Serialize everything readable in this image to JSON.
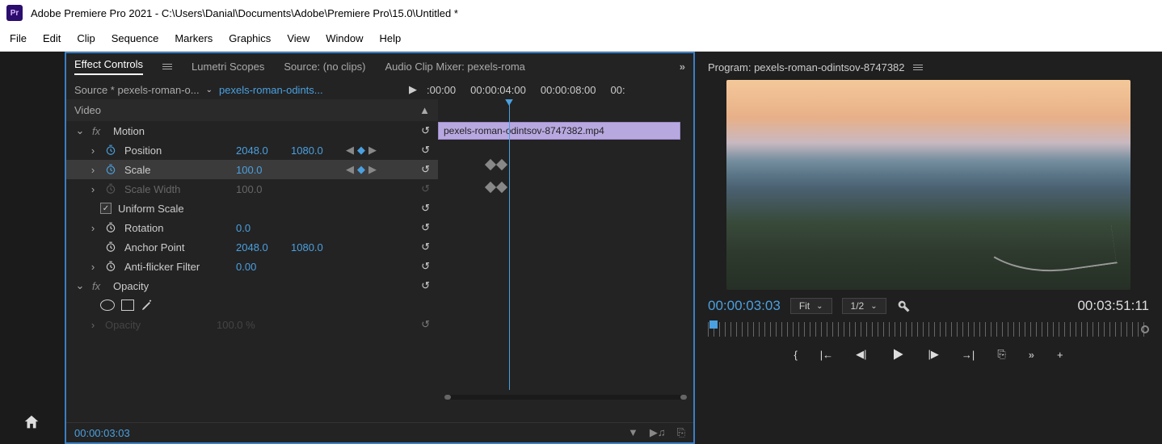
{
  "window_title": "Adobe Premiere Pro 2021 - C:\\Users\\Danial\\Documents\\Adobe\\Premiere Pro\\15.0\\Untitled *",
  "app_icon_text": "Pr",
  "menu": {
    "file": "File",
    "edit": "Edit",
    "clip": "Clip",
    "sequence": "Sequence",
    "markers": "Markers",
    "graphics": "Graphics",
    "view": "View",
    "window": "Window",
    "help": "Help"
  },
  "tabs": {
    "effect_controls": "Effect Controls",
    "lumetri": "Lumetri Scopes",
    "source": "Source: (no clips)",
    "audio_mixer": "Audio Clip Mixer: pexels-roma"
  },
  "source_line": {
    "src": "Source * pexels-roman-o...",
    "seq": "pexels-roman-odints..."
  },
  "time_ruler": {
    "t0": ":00:00",
    "t1": "00:00:04:00",
    "t2": "00:00:08:00",
    "t3": "00:"
  },
  "video_header": "Video",
  "effects": {
    "motion": {
      "label": "Motion"
    },
    "position": {
      "label": "Position",
      "x": "2048.0",
      "y": "1080.0"
    },
    "scale": {
      "label": "Scale",
      "val": "100.0"
    },
    "scale_width": {
      "label": "Scale Width",
      "val": "100.0"
    },
    "uniform_scale": {
      "label": "Uniform Scale"
    },
    "rotation": {
      "label": "Rotation",
      "val": "0.0"
    },
    "anchor": {
      "label": "Anchor Point",
      "x": "2048.0",
      "y": "1080.0"
    },
    "anti_flicker": {
      "label": "Anti-flicker Filter",
      "val": "0.00"
    },
    "opacity": {
      "label": "Opacity",
      "val": "100.0 %"
    }
  },
  "clip_name": "pexels-roman-odintsov-8747382.mp4",
  "footer_tc": "00:00:03:03",
  "program": {
    "header": "Program: pexels-roman-odintsov-8747382",
    "tc": "00:00:03:03",
    "zoom": "Fit",
    "res": "1/2",
    "duration": "00:03:51:11"
  }
}
